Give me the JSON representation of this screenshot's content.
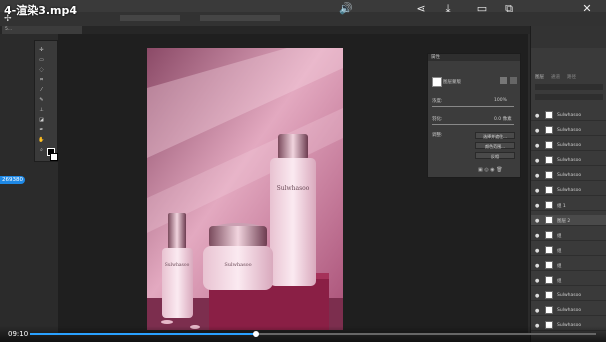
{
  "video": {
    "title": "4-渲染3.mp4",
    "time": "09:10",
    "progress": 0.4
  },
  "badge": {
    "text": "269380"
  },
  "doc_tab": {
    "label": "5..."
  },
  "properties": {
    "header": "属性",
    "section": "图层蒙版",
    "density_label": "浓度:",
    "density_value": "100%",
    "feather_label": "羽化:",
    "feather_value": "0.0 像素",
    "refine_label": "调整:",
    "btn_select_mask": "选择并遮住...",
    "btn_color_range": "颜色范围...",
    "btn_invert": "反相"
  },
  "right_panel": {
    "tabs": [
      "图层",
      "通道",
      "路径"
    ],
    "layers": [
      {
        "name": "Sulwhasoo"
      },
      {
        "name": "Sulwhasoo"
      },
      {
        "name": "Sulwhasoo"
      },
      {
        "name": "Sulwhasoo"
      },
      {
        "name": "Sulwhasoo"
      },
      {
        "name": "Sulwhasoo"
      },
      {
        "name": "组 1"
      },
      {
        "name": "图层 2"
      },
      {
        "name": "组"
      },
      {
        "name": "组"
      },
      {
        "name": "组"
      },
      {
        "name": "组"
      },
      {
        "name": "Sulwhasoo"
      },
      {
        "name": "Sulwhasoo"
      },
      {
        "name": "Sulwhasoo"
      }
    ]
  },
  "product": {
    "brand_big": "Sulwhasoo",
    "brand_small": "Sulwhasoo",
    "brand_jar": "Sulwhasoo"
  },
  "colors": {
    "accent": "#1e88e5",
    "photo_bg": "#c26a8e"
  }
}
